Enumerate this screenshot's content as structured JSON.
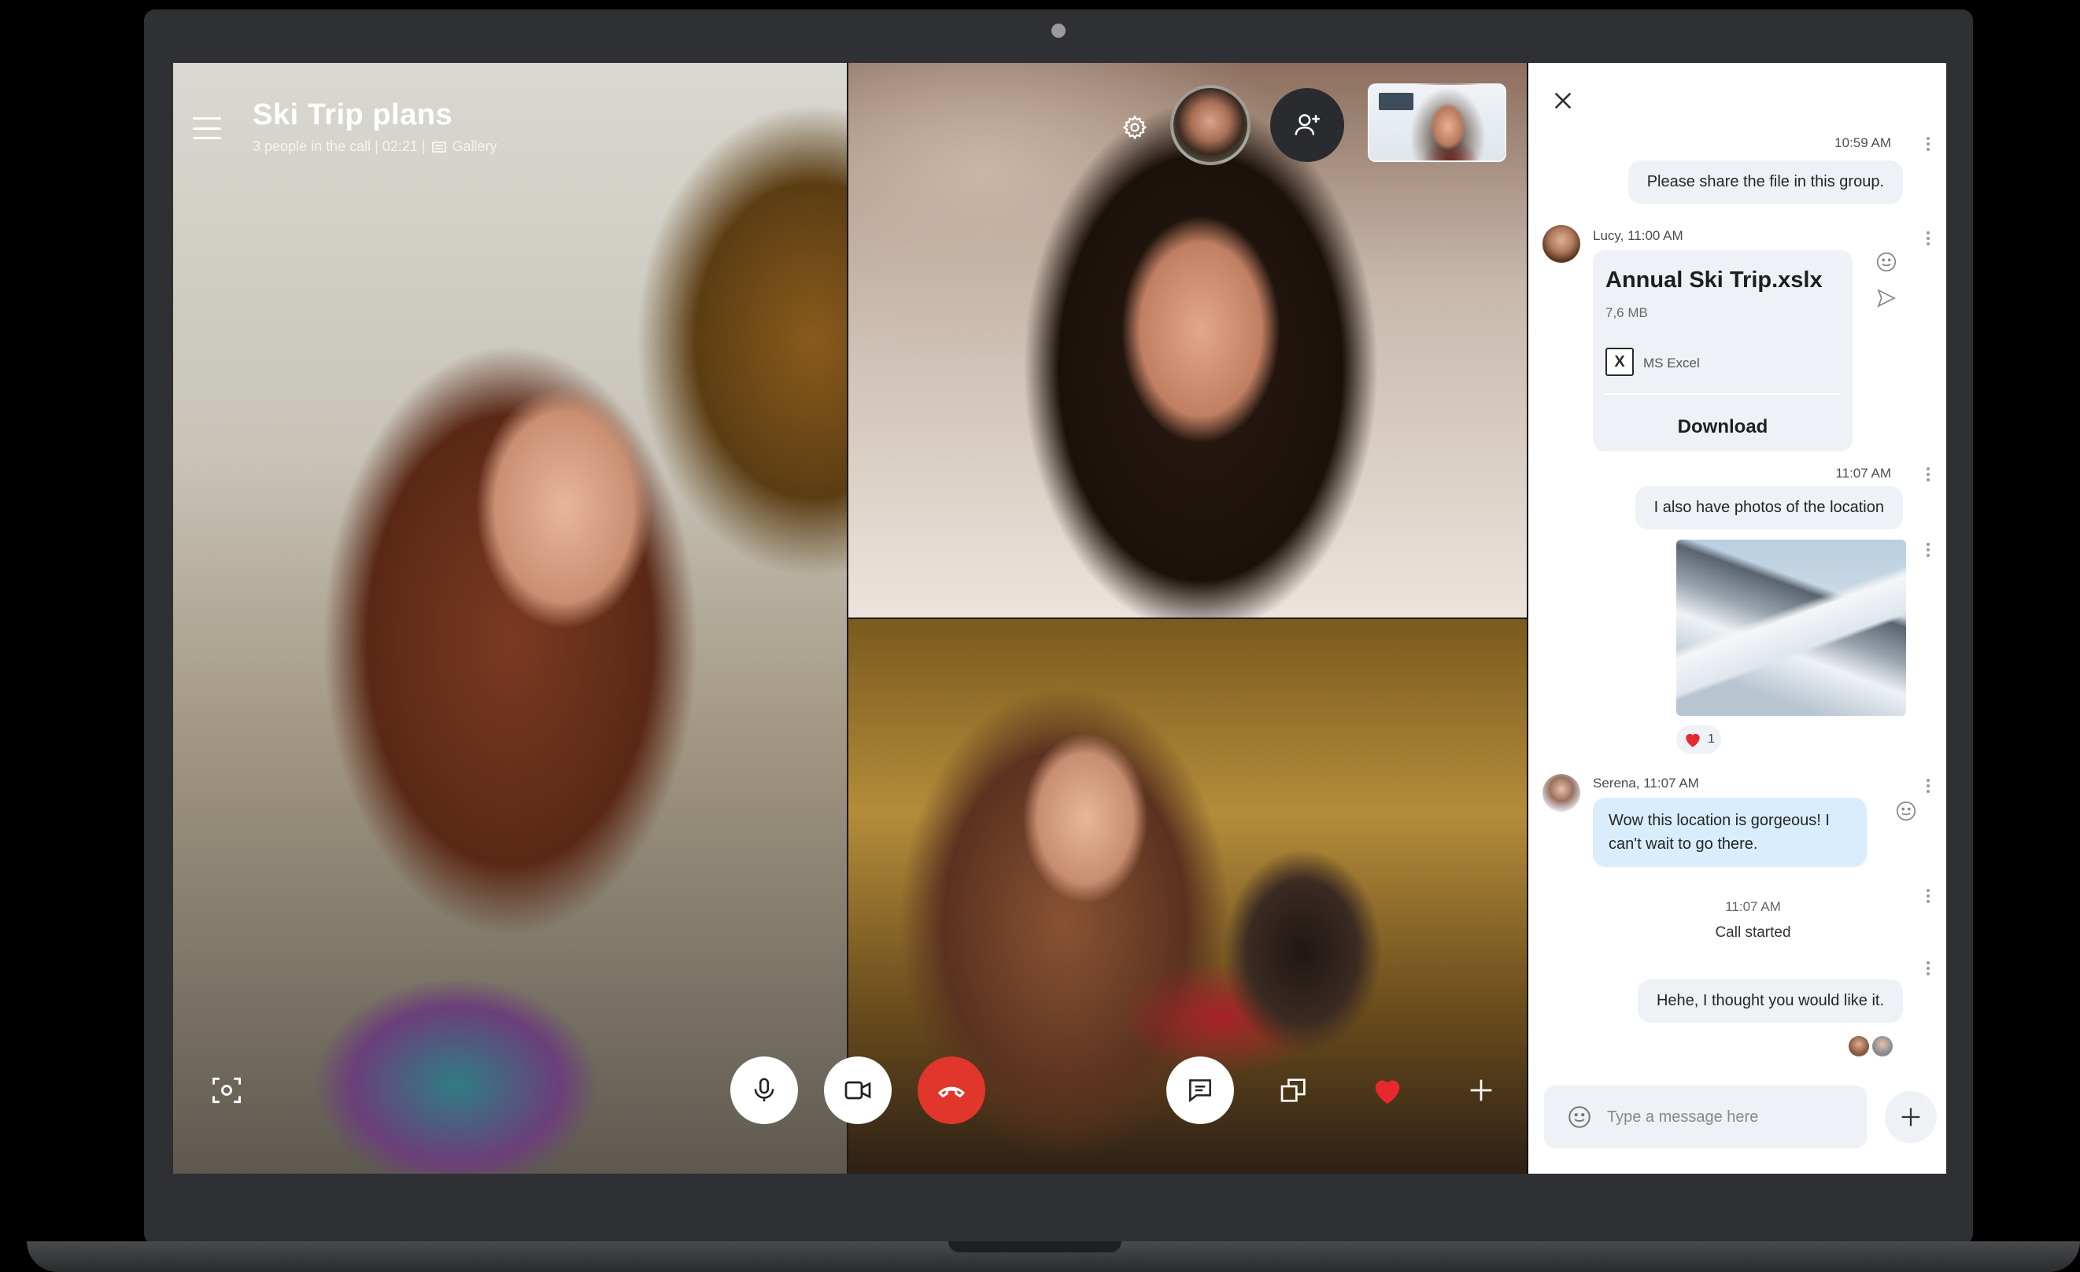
{
  "call": {
    "title": "Ski Trip plans",
    "subtitle": "3 people in the call | 02:21 |",
    "view_label": "Gallery"
  },
  "colors": {
    "end_call": "#e0362c",
    "heart": "#e8282f",
    "panel_bg": "#ffffff",
    "bubble_out": "#eef1f5",
    "bubble_in": "#d9edfc"
  },
  "icons": {
    "menu": "hamburger-icon",
    "settings": "gear-icon",
    "add_person": "add-person-icon",
    "screenshot": "screenshot-icon",
    "mic": "microphone-icon",
    "video": "video-camera-icon",
    "end_call": "hang-up-icon",
    "chat": "chat-icon",
    "share": "screen-share-icon",
    "heart": "heart-icon",
    "plus": "plus-icon",
    "close": "close-icon"
  },
  "chat": {
    "messages": [
      {
        "time": "10:59 AM",
        "text": "Please share the file in this group."
      },
      {
        "sender_meta": "Lucy, 11:00 AM"
      },
      {
        "time": "11:07 AM",
        "text": "I also have photos of the location"
      },
      {
        "sender_meta": "Serena, 11:07 AM",
        "text": "Wow this location is gorgeous! I can't wait to go there."
      },
      {
        "time": "11:07 AM",
        "text": "Hehe, I thought you would like it."
      }
    ],
    "file": {
      "name": "Annual Ski Trip.xslx",
      "size": "7,6 MB",
      "app": "MS Excel",
      "download_label": "Download"
    },
    "reaction_count": "1",
    "call_started_time": "11:07 AM",
    "call_started_label": "Call started",
    "compose_placeholder": "Type a message here"
  }
}
